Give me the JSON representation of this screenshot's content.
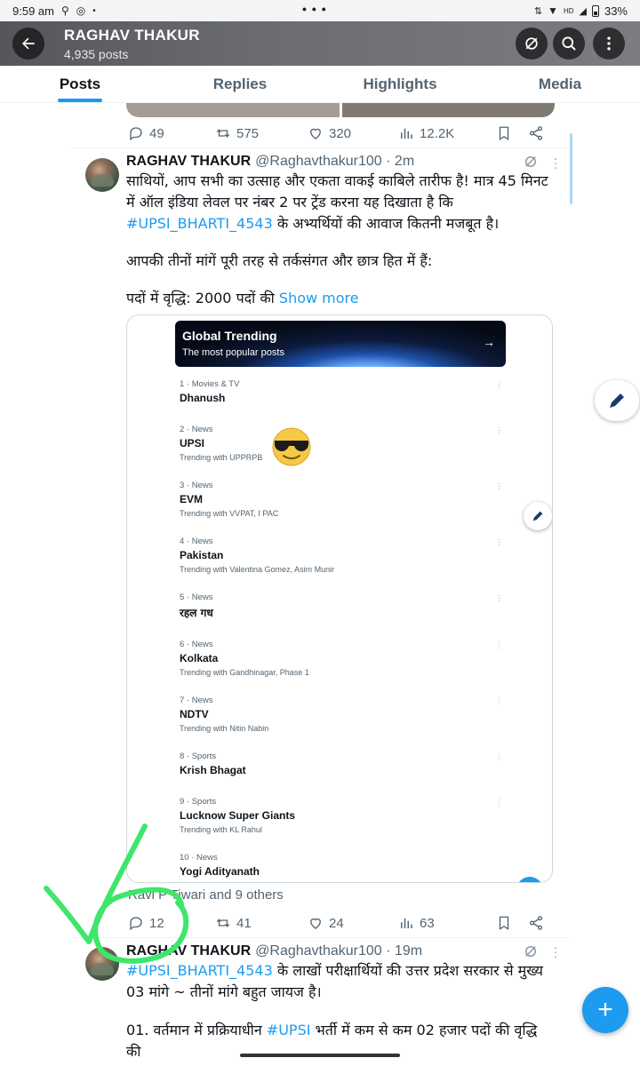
{
  "status_bar": {
    "time": "9:59 am",
    "battery": "33%",
    "net": "HD"
  },
  "header": {
    "back_icon": "arrow-left-icon",
    "title": "RAGHAV THAKUR",
    "subtitle": "4,935 posts",
    "grok_icon": "grok-icon",
    "search_icon": "search-icon",
    "more_icon": "more-vertical-icon"
  },
  "tabs": [
    {
      "label": "Posts",
      "active": true
    },
    {
      "label": "Replies",
      "active": false
    },
    {
      "label": "Highlights",
      "active": false
    },
    {
      "label": "Media",
      "active": false
    }
  ],
  "previous_post": {
    "actions": {
      "replies": "49",
      "reposts": "575",
      "likes": "320",
      "views": "12.2K"
    }
  },
  "post1": {
    "name": "RAGHAV THAKUR",
    "handle": "@Raghavthakur100 · 2m",
    "line1": "साथियों, आप सभी का उत्साह और एकता वाकई काबिले तारीफ है! मात्र 45 मिनट में ऑल इंडिया लेवल पर नंबर 2 पर ट्रेंड करना यह दिखाता है कि ",
    "hashtag": "#UPSI_BHARTI_4543",
    "line1_end": " के अभ्यर्थियों की आवाज कितनी मजबूत है।",
    "para2": "आपकी तीनों मांगें पूरी तरह से तर्कसंगत और छात्र हित में हैं:",
    "para3": "पदों में वृद्धि: 2000 पदों की ",
    "show_more": "Show more",
    "card": {
      "banner_title": "Global Trending",
      "banner_sub": "The most popular posts",
      "trends": [
        {
          "meta": "1 · Movies & TV",
          "name": "Dhanush",
          "with": ""
        },
        {
          "meta": "2 · News",
          "name": "UPSI",
          "with": "Trending with UPPRPB"
        },
        {
          "meta": "3 · News",
          "name": "EVM",
          "with": "Trending with VVPAT, I PAC"
        },
        {
          "meta": "4 · News",
          "name": "Pakistan",
          "with": "Trending with Valentina Gomez, Asim Munir"
        },
        {
          "meta": "5 · News",
          "name": "रहल गध",
          "with": ""
        },
        {
          "meta": "6 · News",
          "name": "Kolkata",
          "with": "Trending with Gandhinagar, Phase 1"
        },
        {
          "meta": "7 · News",
          "name": "NDTV",
          "with": "Trending with Nitin Nabin"
        },
        {
          "meta": "8 · Sports",
          "name": "Krish Bhagat",
          "with": ""
        },
        {
          "meta": "9 · Sports",
          "name": "Lucknow Super Giants",
          "with": "Trending with KL Rahul"
        },
        {
          "meta": "10 · News",
          "name": "Yogi Adityanath",
          "with": ""
        }
      ]
    },
    "liked_by": "Ravi P Tiwari and 9 others",
    "actions": {
      "replies": "12",
      "reposts": "41",
      "likes": "24",
      "views": "63"
    }
  },
  "post2": {
    "name": "RAGHAV THAKUR",
    "handle": "@Raghavthakur100 · 19m",
    "hashtag": "#UPSI_BHARTI_4543",
    "line1_rest": " के लाखों परीक्षार्थियों की उत्तर प्रदेश सरकार से मुख्य 03 मांगे ~ तीनों मांगे बहुत जायज है।",
    "line3_a": "01. वर्तमान में प्रक्रियाधीन ",
    "hashtag2": "#UPSI",
    "line3_b": " भर्ती में कम से कम 02 हजार पदों की वृद्धि की"
  },
  "colors": {
    "accent": "#1d9bf0",
    "annotation": "#3ee66b"
  }
}
